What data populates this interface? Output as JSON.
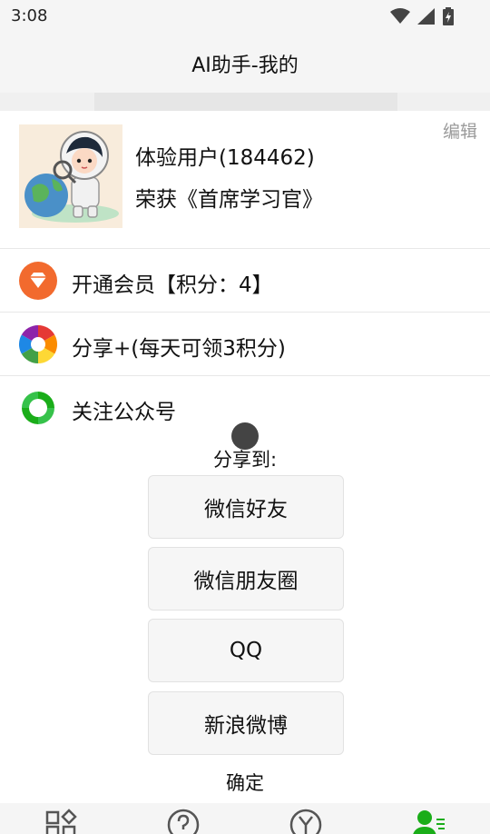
{
  "status_bar": {
    "time": "3:08"
  },
  "header": {
    "title": "AI助手-我的"
  },
  "profile": {
    "name": "体验用户(184462)",
    "honor": "荣获《首席学习官》",
    "edit_label": "编辑"
  },
  "menu": [
    {
      "label": "开通会员【积分：4】",
      "icon": "diamond-icon",
      "color": "#f26a2e"
    },
    {
      "label": "分享+(每天可领3积分)",
      "icon": "aperture-icon"
    },
    {
      "label": "关注公众号",
      "icon": "wechat-official-account-icon",
      "color": "#1aad19"
    }
  ],
  "share_sheet": {
    "title": "分享到:",
    "options": [
      "微信好友",
      "微信朋友圈",
      "QQ",
      "新浪微博"
    ],
    "confirm_label": "确定"
  },
  "tab_bar": {
    "items": [
      {
        "icon": "apps-grid-icon"
      },
      {
        "icon": "help-circle-icon"
      },
      {
        "icon": "yen-circle-icon"
      },
      {
        "icon": "user-profile-icon",
        "active": true,
        "color": "#1aad19"
      }
    ]
  }
}
